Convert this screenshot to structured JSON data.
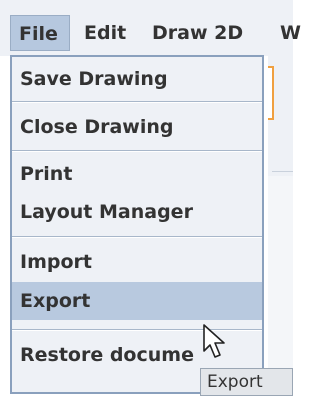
{
  "menubar": {
    "items": [
      {
        "label": "File",
        "active": true
      },
      {
        "label": "Edit"
      },
      {
        "label": "Draw 2D"
      },
      {
        "label": "W"
      }
    ]
  },
  "file_menu": {
    "groups": [
      [
        {
          "label": "Save Drawing"
        }
      ],
      [
        {
          "label": "Close Drawing"
        }
      ],
      [
        {
          "label": "Print"
        },
        {
          "label": "Layout Manager"
        }
      ],
      [
        {
          "label": "Import"
        },
        {
          "label": "Export",
          "highlighted": true
        }
      ],
      [
        {
          "label": "Restore docume"
        }
      ]
    ]
  },
  "tooltip": {
    "text": "Export"
  },
  "cursor": {
    "icon": "arrow-cursor-icon"
  },
  "colors": {
    "menu_bg": "#eef1f6",
    "highlight": "#b8c9df",
    "menu_border": "#8aa0bd",
    "focus_accent": "#f0a040"
  }
}
